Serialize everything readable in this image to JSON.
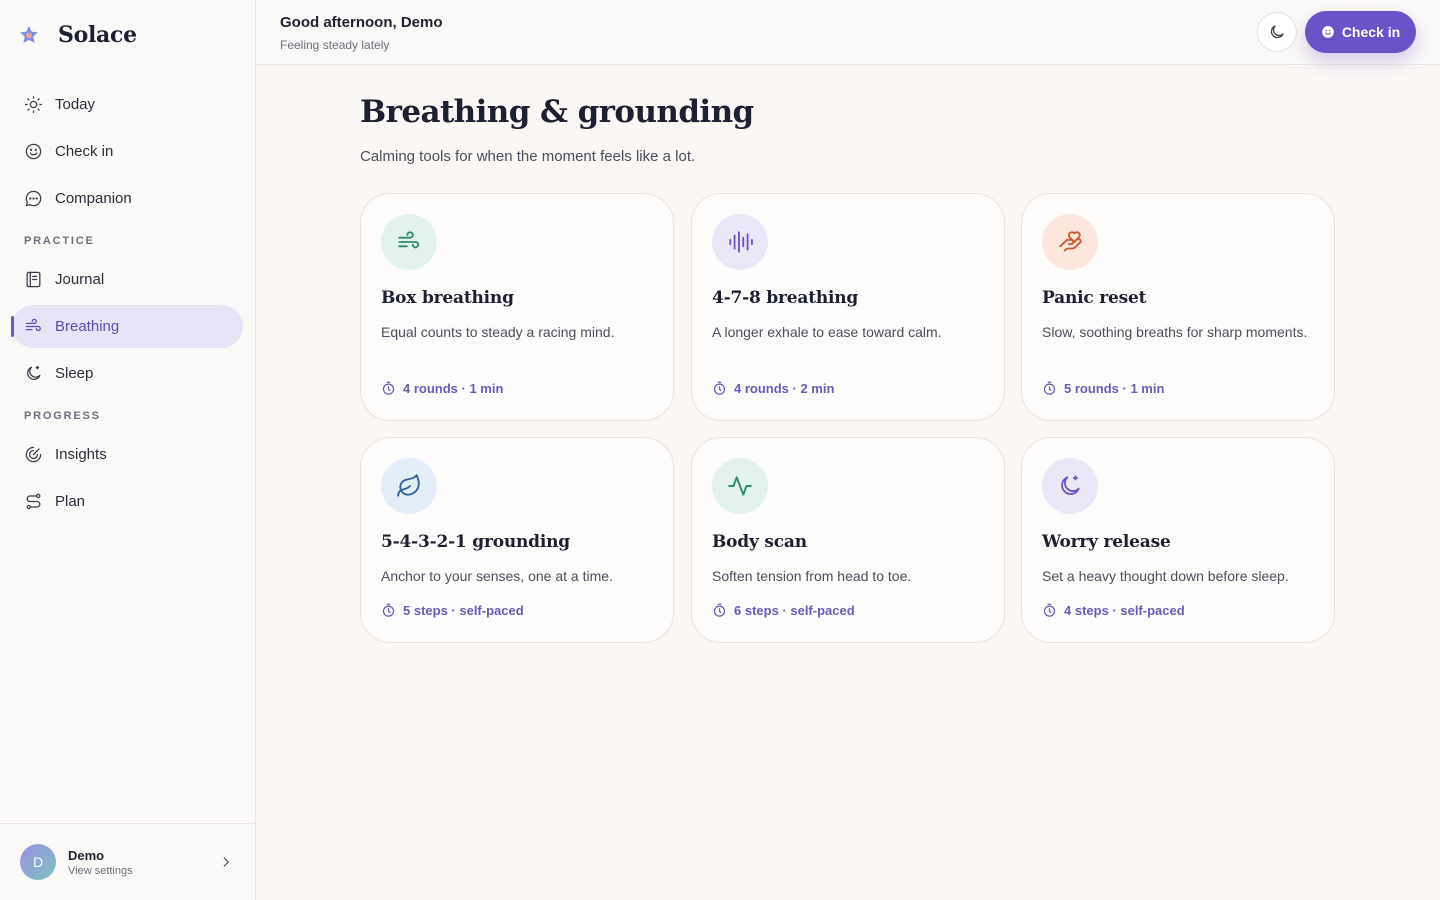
{
  "app": {
    "name": "Solace"
  },
  "nav": {
    "top": [
      {
        "label": "Today",
        "icon": "sun-icon"
      },
      {
        "label": "Check in",
        "icon": "smile-icon"
      },
      {
        "label": "Companion",
        "icon": "chat-icon"
      }
    ],
    "practice_label": "PRACTICE",
    "practice": [
      {
        "label": "Journal",
        "icon": "journal-icon"
      },
      {
        "label": "Breathing",
        "icon": "wind-icon",
        "active": true
      },
      {
        "label": "Sleep",
        "icon": "moon-stars-icon"
      }
    ],
    "progress_label": "PROGRESS",
    "progress": [
      {
        "label": "Insights",
        "icon": "insights-icon"
      },
      {
        "label": "Plan",
        "icon": "route-icon"
      }
    ]
  },
  "user": {
    "initial": "D",
    "name": "Demo",
    "sub": "View settings"
  },
  "header": {
    "greeting": "Good afternoon, Demo",
    "status": "Feeling steady lately",
    "checkin_label": "Check in"
  },
  "page": {
    "title": "Breathing & grounding",
    "subtitle": "Calming tools for when the moment feels like a lot."
  },
  "cards": [
    {
      "title": "Box breathing",
      "desc": "Equal counts to steady a racing mind.",
      "meta": "4 rounds · 1 min",
      "icon": "wind-icon"
    },
    {
      "title": "4-7-8 breathing",
      "desc": "A longer exhale to ease toward calm.",
      "meta": "4 rounds · 2 min",
      "icon": "audio-lines-icon"
    },
    {
      "title": "Panic reset",
      "desc": "Slow, soothing breaths for sharp moments.",
      "meta": "5 rounds · 1 min",
      "icon": "hand-heart-icon"
    },
    {
      "title": "5-4-3-2-1 grounding",
      "desc": "Anchor to your senses, one at a time.",
      "meta": "5 steps · self-paced",
      "icon": "leaf-icon"
    },
    {
      "title": "Body scan",
      "desc": "Soften tension from head to toe.",
      "meta": "6 steps · self-paced",
      "icon": "activity-icon"
    },
    {
      "title": "Worry release",
      "desc": "Set a heavy thought down before sleep.",
      "meta": "4 steps · self-paced",
      "icon": "moon-stars-icon"
    }
  ],
  "colors": {
    "accent": "#6a52c9",
    "active_bg": "#e8e3f7",
    "teal_bg": "#e2f3ee",
    "purple_bg": "#ebe7f9",
    "orange_bg": "#fde6dc",
    "blue_bg": "#e4eefb"
  }
}
